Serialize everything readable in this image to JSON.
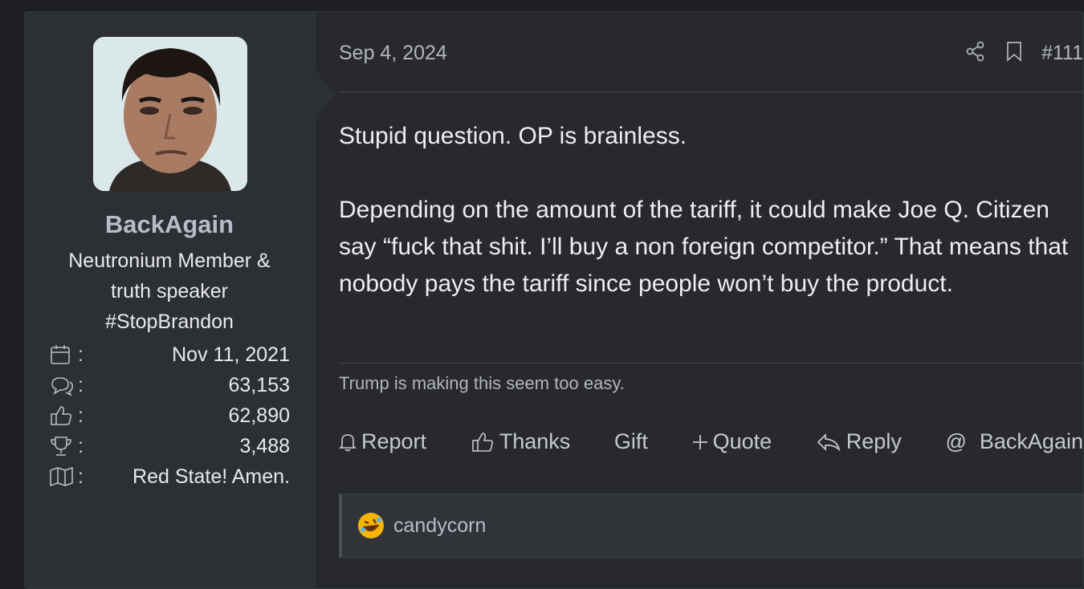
{
  "user": {
    "name": "BackAgain",
    "title_lines": [
      "Neutronium Member &",
      "truth speaker",
      "#StopBrandon"
    ],
    "stats": [
      {
        "icon": "calendar-icon",
        "value": "Nov 11, 2021"
      },
      {
        "icon": "messages-icon",
        "value": "63,153"
      },
      {
        "icon": "thumbs-up-icon",
        "value": "62,890"
      },
      {
        "icon": "trophy-icon",
        "value": "3,488"
      },
      {
        "icon": "map-icon",
        "value": "Red State! Amen."
      }
    ]
  },
  "post": {
    "date": "Sep 4, 2024",
    "number": "#111",
    "body": [
      "Stupid question. OP is brainless.",
      "Depending on the amount of the tariff, it could make Joe Q. Citizen say “fuck that shit. I’ll buy a non foreign competitor.” That means that nobody pays the tariff since people won’t buy the product."
    ],
    "signature": "Trump is making this seem too easy."
  },
  "actions": {
    "report": "Report",
    "thanks": "Thanks",
    "gift": "Gift",
    "quote": "Quote",
    "reply": "Reply",
    "mention": "BackAgain"
  },
  "reactions": {
    "user": "candycorn",
    "emoji": "rolling-laughing-emoji"
  },
  "colors": {
    "background": "#1c1e22",
    "panel": "#27292e",
    "user_panel": "#2c2f34",
    "username": "#b8bcc8"
  }
}
